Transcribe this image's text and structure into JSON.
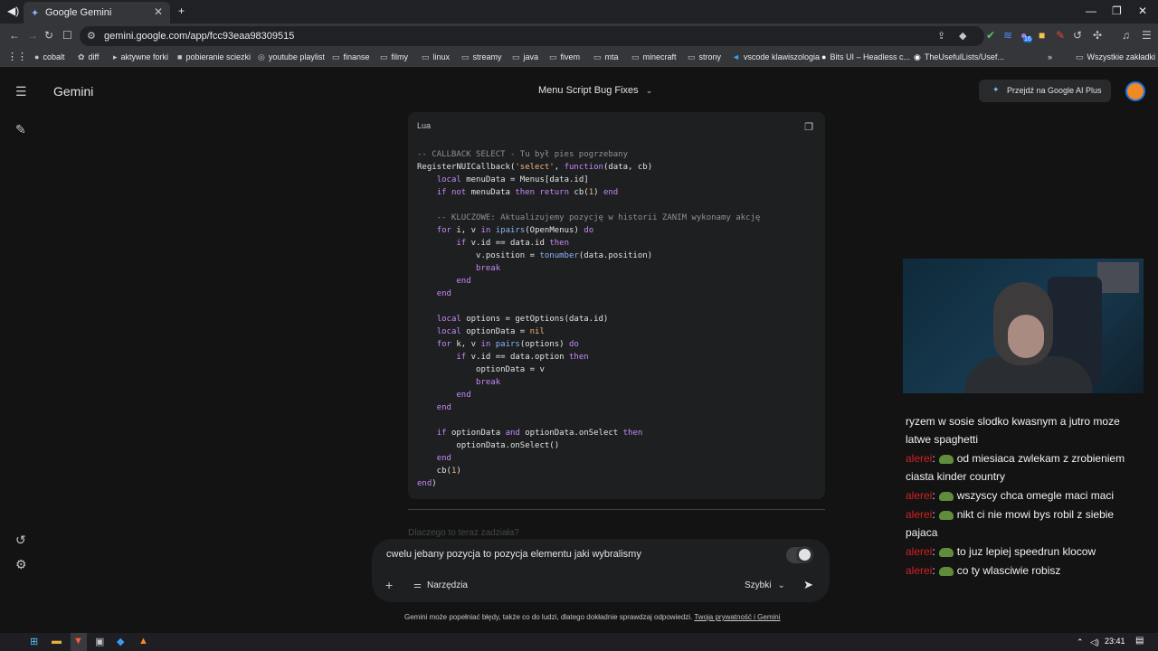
{
  "browser": {
    "tab_title": "Google Gemini",
    "url": "gemini.google.com/app/fcc93eaa98309515",
    "bookmarks": [
      "cobalt",
      "diff",
      "aktywne forki",
      "pobieranie sciezki",
      "youtube playlist",
      "finanse",
      "filmy",
      "linux",
      "streamy",
      "java",
      "fivem",
      "mta",
      "minecraft",
      "strony",
      "vscode klawiszologia",
      "Bits UI – Headless c...",
      "TheUsefulLists/Usef..."
    ],
    "all_bookmarks": "Wszystkie zakładki",
    "extension_badge": "16"
  },
  "app": {
    "logo": "Gemini",
    "conversation_title": "Menu Script Bug Fixes",
    "upgrade_label": "Przejdź na Google AI Plus"
  },
  "code_block": {
    "language": "Lua",
    "lines": [
      "-- CALLBACK SELECT - Tu był pies pogrzebany",
      "RegisterNUICallback('select', function(data, cb)",
      "    local menuData = Menus[data.id]",
      "    if not menuData then return cb(1) end",
      "",
      "    -- KLUCZOWE: Aktualizujemy pozycję w historii ZANIM wykonamy akcję",
      "    for i, v in ipairs(OpenMenus) do",
      "        if v.id == data.id then",
      "            v.position = tonumber(data.position)",
      "            break",
      "        end",
      "    end",
      "",
      "    local options = getOptions(data.id)",
      "    local optionData = nil",
      "    for k, v in pairs(options) do",
      "        if v.id == data.option then",
      "            optionData = v",
      "            break",
      "        end",
      "    end",
      "",
      "    if optionData and optionData.onSelect then",
      "        optionData.onSelect()",
      "    end",
      "    cb(1)",
      "end)"
    ]
  },
  "faded_question": "Dlaczego to teraz zadziała?",
  "input": {
    "value": "cwelu jebany pozycja to pozycja elementu jaki wybralismy",
    "tools_label": "Narzędzia",
    "model_label": "Szybki"
  },
  "disclaimer": {
    "text": "Gemini może popełniać błędy, także co do ludzi, dlatego dokładnie sprawdzaj odpowiedzi. ",
    "link": "Twoja prywatność i Gemini"
  },
  "chat": [
    {
      "user": "",
      "text": "ryzem w sosie slodko kwasnym a jutro moze latwe spaghetti"
    },
    {
      "user": "alerei",
      "text": "od miesiaca zwlekam z zrobieniem ciasta kinder country"
    },
    {
      "user": "alerei",
      "text": "wszyscy chca omegle maci maci"
    },
    {
      "user": "alerei",
      "text": "nikt ci nie mowi bys robil z siebie pajaca"
    },
    {
      "user": "alerei",
      "text": "to juz lepiej speedrun klocow"
    },
    {
      "user": "alerei",
      "text": "co ty wlasciwie robisz"
    }
  ],
  "taskbar": {
    "time": "23:41"
  },
  "colors": {
    "background": "#131314",
    "code_bg": "#1e1f20",
    "keyword": "#c58af9",
    "string": "#f4b27f",
    "comment": "#8e9196",
    "chat_user": "#d42020"
  }
}
